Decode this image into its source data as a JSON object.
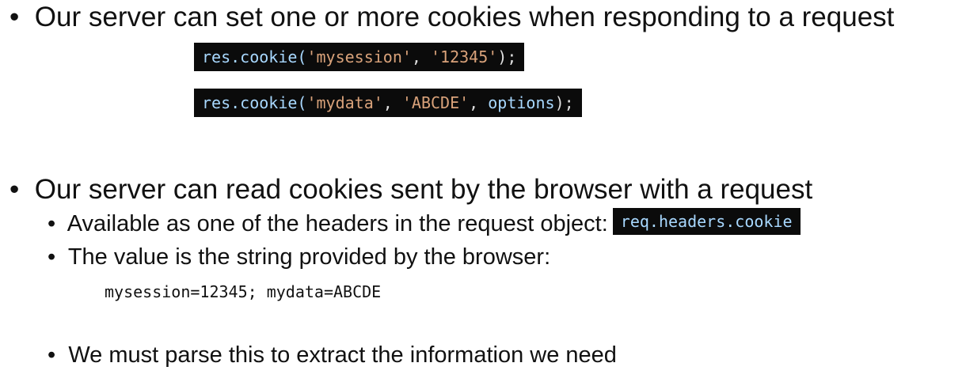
{
  "bullets": {
    "set_cookies": {
      "marker": "•",
      "text": "Our server can set one or more cookies when responding to a request",
      "code1": {
        "fn": "res.cookie(",
        "arg1": "'mysession'",
        "sep": ", ",
        "arg2": "'12345'",
        "end": ");"
      },
      "code2": {
        "fn": "res.cookie(",
        "arg1": "'mydata'",
        "sep1": ", ",
        "arg2": "'ABCDE'",
        "sep2": ", ",
        "arg3": "options",
        "end": ");"
      }
    },
    "read_cookies": {
      "marker": "•",
      "text": "Our server can read cookies sent by the browser with a request",
      "sub1": {
        "marker": "•",
        "text": "Available as one of the headers in the request object:",
        "code": "req.headers.cookie"
      },
      "sub2": {
        "marker": "•",
        "text": "The value is the string provided by the browser:",
        "code": "mysession=12345; mydata=ABCDE"
      },
      "sub3": {
        "marker": "•",
        "text": "We must parse this to extract the information we need"
      }
    }
  }
}
